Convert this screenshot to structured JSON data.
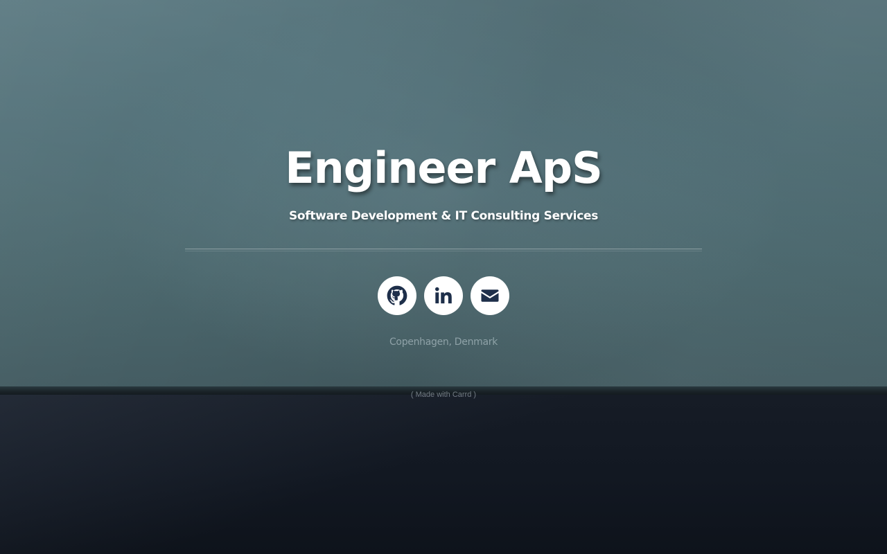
{
  "header": {
    "title": "Engineer ApS",
    "subtitle": "Software Development & IT Consulting Services"
  },
  "social": {
    "items": [
      {
        "name": "github",
        "icon": "github-icon"
      },
      {
        "name": "linkedin",
        "icon": "linkedin-icon"
      },
      {
        "name": "email",
        "icon": "envelope-icon"
      }
    ],
    "icon_color": "#1e2f4a",
    "button_background": "#ffffff"
  },
  "footer": {
    "location": "Copenhagen, Denmark",
    "credit_open": "( ",
    "credit_link": "Made with Carrd",
    "credit_close": " )"
  }
}
